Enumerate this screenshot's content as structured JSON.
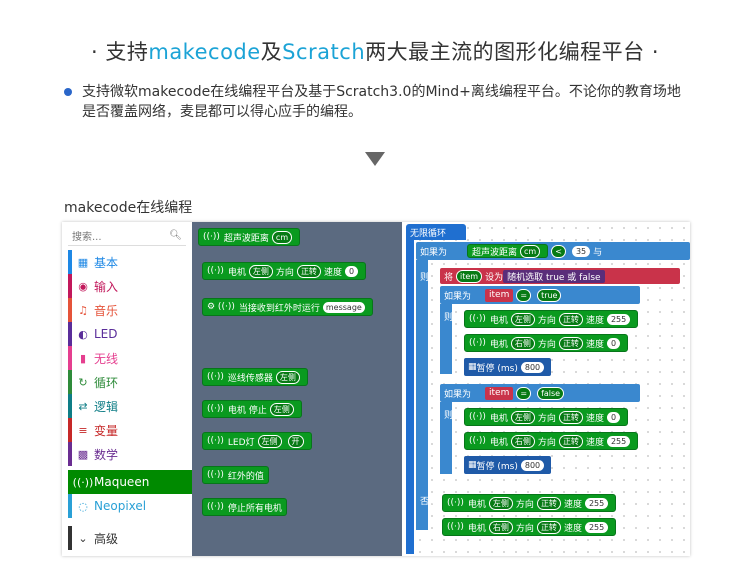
{
  "heading": {
    "prefix": "·",
    "part1": "支持",
    "part2": "makecode",
    "part3": "及",
    "part4": "Scratch",
    "part5": "两大最主流的图形化编程平台",
    "suffix": "·"
  },
  "bullet": "支持微软makecode在线编程平台及基于Scratch3.0的Mind+离线编程平台。不论你的教育场地是否覆盖网络，麦昆都可以得心应手的编程。",
  "editor_title": "makecode在线编程",
  "toolbox": {
    "search_placeholder": "搜索...",
    "categories": [
      {
        "label": "基本",
        "icon": "▦",
        "color": "#1e88e5"
      },
      {
        "label": "输入",
        "icon": "◉",
        "color": "#c2185b"
      },
      {
        "label": "音乐",
        "icon": "♫",
        "color": "#e5533a"
      },
      {
        "label": "LED",
        "icon": "◐",
        "color": "#5a2d9a"
      },
      {
        "label": "无线",
        "icon": "▮",
        "color": "#e53f8f"
      },
      {
        "label": "循环",
        "icon": "↻",
        "color": "#2e8b3a"
      },
      {
        "label": "逻辑",
        "icon": "⇄",
        "color": "#0e7d86"
      },
      {
        "label": "变量",
        "icon": "≡",
        "color": "#c62828"
      },
      {
        "label": "数学",
        "icon": "▩",
        "color": "#6a2d91"
      },
      {
        "label": "Maqueen",
        "icon": "((·))",
        "color": "#008a00"
      },
      {
        "label": "Neopixel",
        "icon": "◌",
        "color": "#2aa0d6"
      },
      {
        "label": "高级",
        "icon": "⌄",
        "color": "#333333"
      }
    ]
  },
  "flyout": {
    "blocks": [
      {
        "text": "超声波距离",
        "dd": "cm"
      },
      {
        "text": "电机",
        "dd": "左侧",
        "text2": "方向",
        "dd2": "正转",
        "text3": "速度",
        "num": "0"
      },
      {
        "text": "当接收到红外时运行",
        "dd": "message"
      },
      {
        "text": "巡线传感器",
        "dd": "左侧"
      },
      {
        "text": "电机 停止",
        "dd": "左侧"
      },
      {
        "text": "LED灯",
        "dd": "左侧",
        "dd2": "开"
      },
      {
        "text": "红外的值"
      },
      {
        "text": "停止所有电机"
      }
    ]
  },
  "workspace": {
    "forever": "无限循环",
    "if1": "如果为",
    "if1_cond_text": "超声波距离",
    "if1_cond_dd": "cm",
    "if1_op": "<",
    "if1_num": "35",
    "if1_and": "与",
    "else_label": "则",
    "set_label": "将",
    "set_var": "item",
    "set_to": "设为",
    "set_val": "随机选取 true 或 false",
    "if2": "如果为",
    "if2_var": "item",
    "if2_op": "=",
    "if2_val": "true",
    "then_label": "则",
    "m1_left": "左侧",
    "m1_dir": "正转",
    "m1_speed": "255",
    "m1_right": "右侧",
    "m1_dir2": "正转",
    "m1_speed2": "0",
    "motor": "电机",
    "direction": "方向",
    "speed": "速度",
    "pause": "暂停 (ms)",
    "pause_val": "800",
    "if3_val": "false",
    "m2_speed": "0",
    "m2_speed2": "255",
    "else2": "否则",
    "m3_speed": "255",
    "m3_speed2": "255"
  }
}
